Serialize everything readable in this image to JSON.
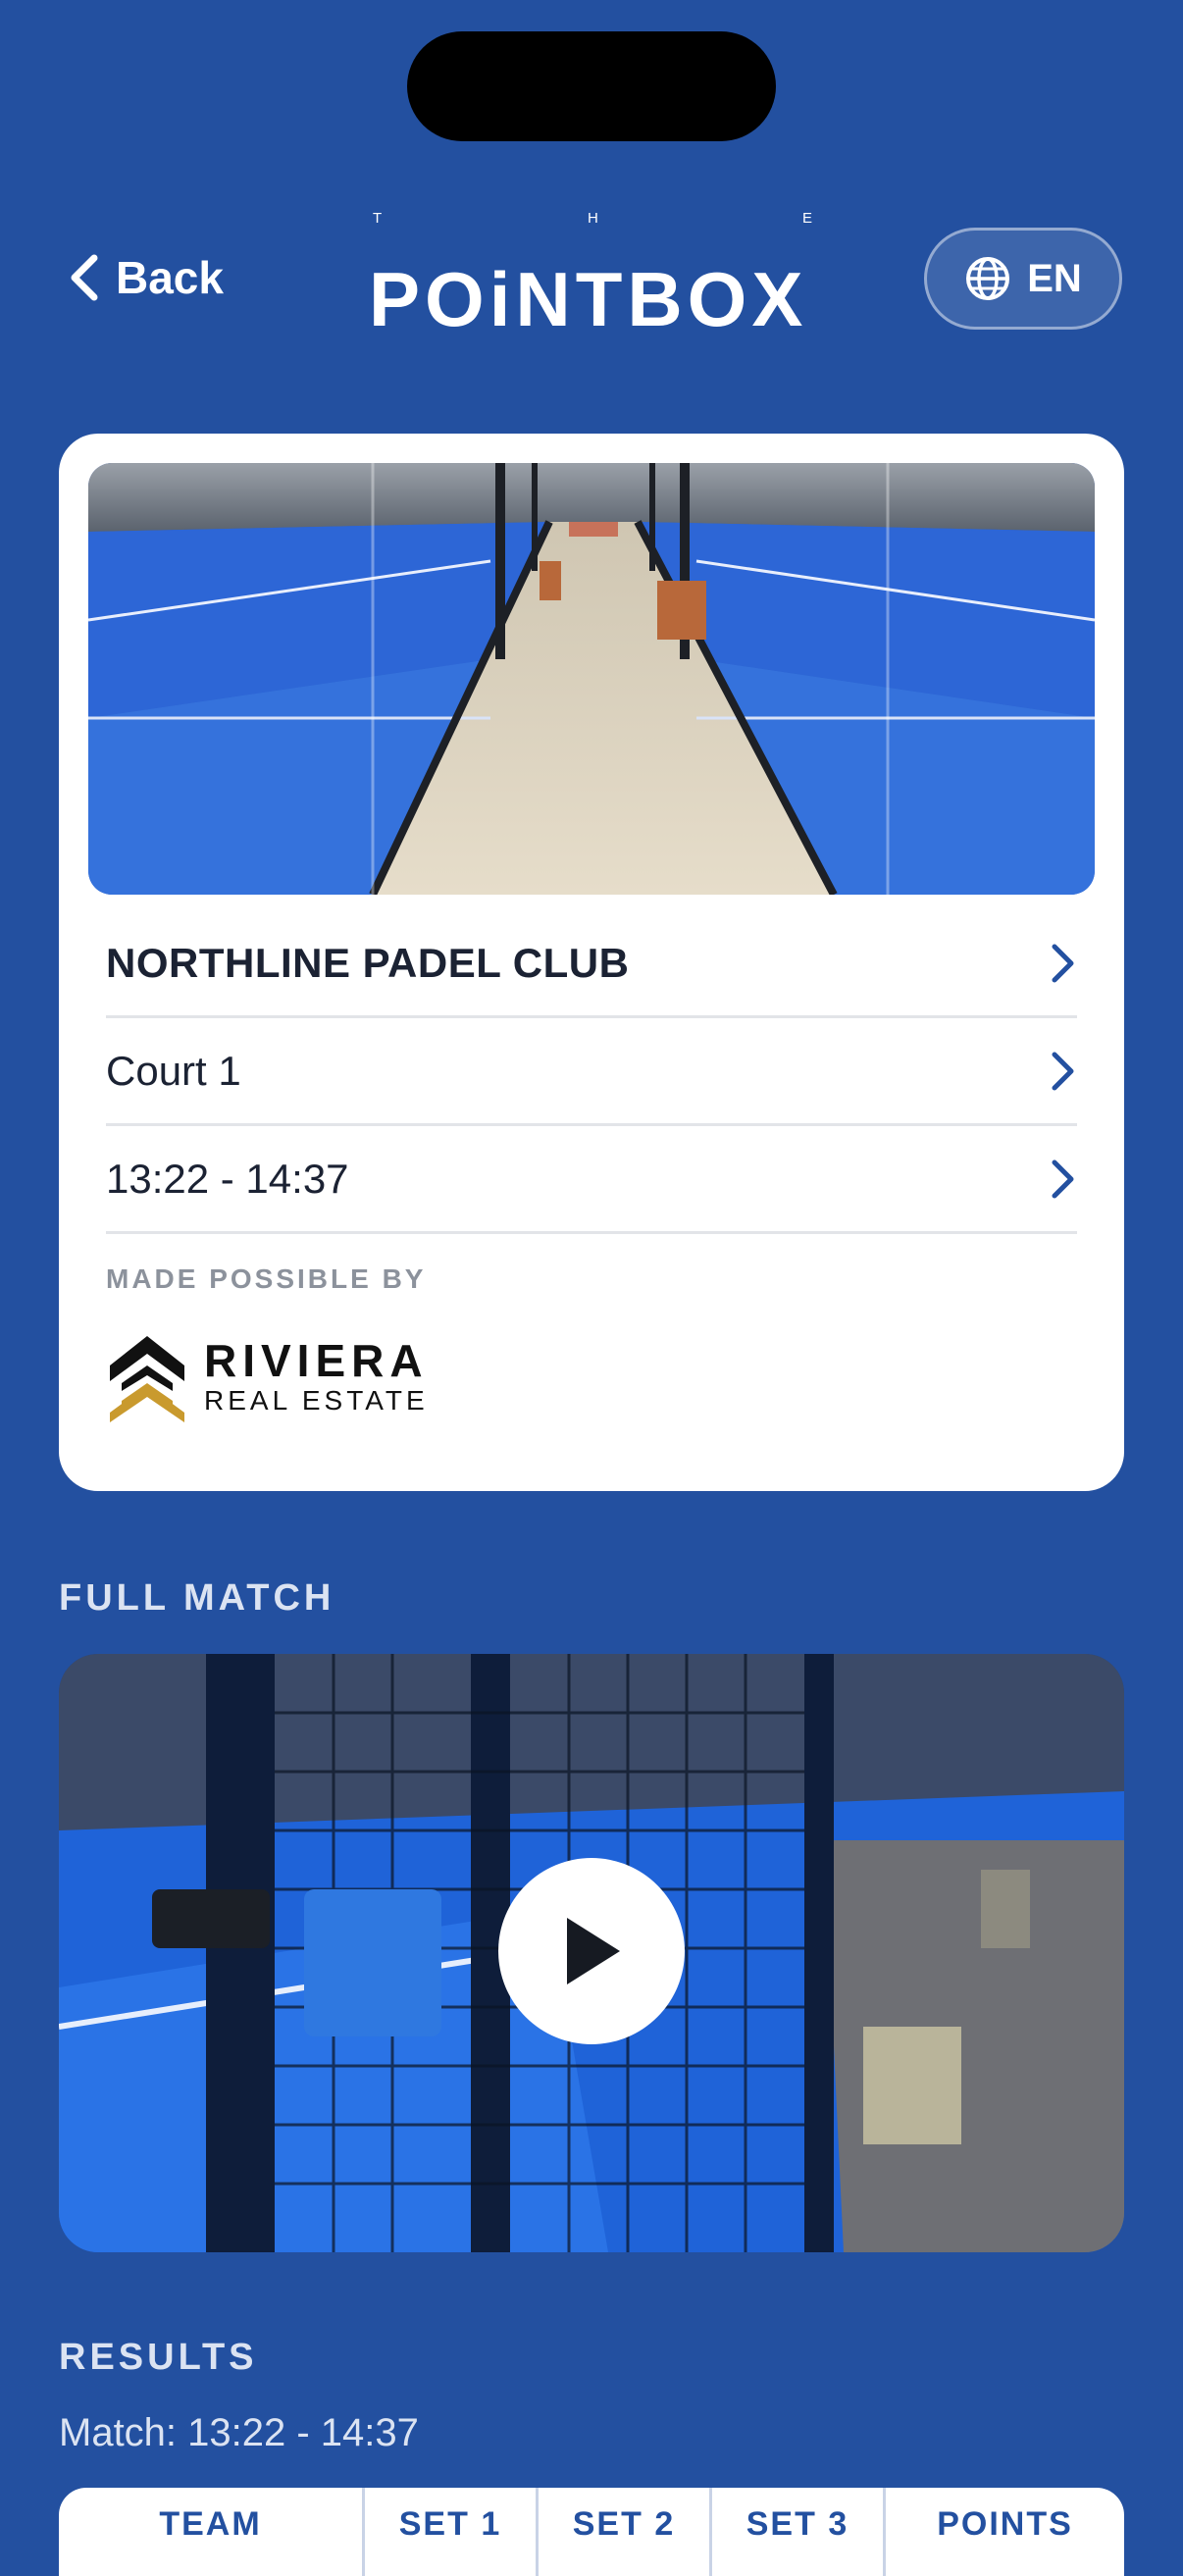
{
  "header": {
    "back_label": "Back",
    "logo_top_letters": [
      "T",
      "H",
      "E"
    ],
    "logo_text": "POiNTBOX",
    "language": "EN"
  },
  "club_card": {
    "club_name": "NORTHLINE PADEL CLUB",
    "court": "Court 1",
    "time_range": "13:22 - 14:37",
    "made_possible_by": "MADE POSSIBLE BY",
    "sponsor_name": "RIVIERA",
    "sponsor_sub": "REAL ESTATE"
  },
  "full_match": {
    "section_title": "FULL MATCH"
  },
  "results": {
    "section_title": "RESULTS",
    "match_label": "Match: 13:22 - 14:37",
    "columns": [
      "TEAM",
      "SET 1",
      "SET 2",
      "SET 3",
      "POINTS"
    ]
  },
  "colors": {
    "background": "#2350a0",
    "accent": "#2350a0",
    "sponsor_gold": "#c99a2e"
  }
}
